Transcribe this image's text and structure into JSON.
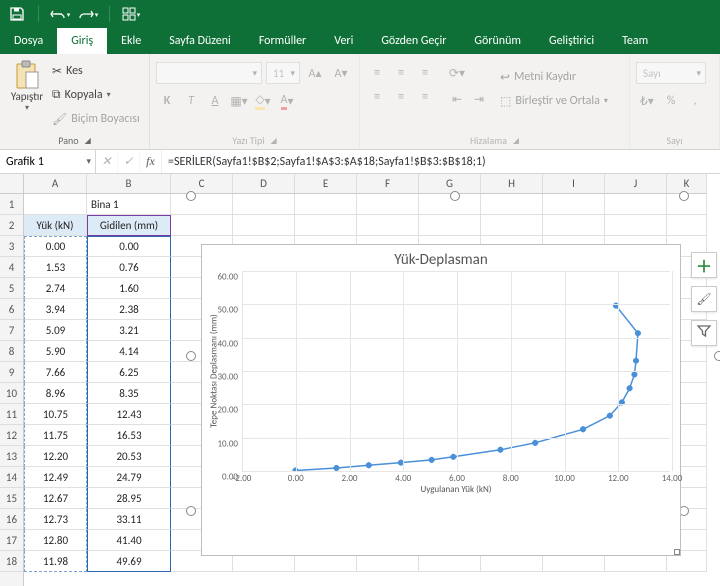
{
  "qat": {
    "items": [
      "save",
      "undo",
      "redo",
      "touch"
    ]
  },
  "ribbon": {
    "tabs": [
      "Dosya",
      "Giriş",
      "Ekle",
      "Sayfa Düzeni",
      "Formüller",
      "Veri",
      "Gözden Geçir",
      "Görünüm",
      "Geliştirici",
      "Team"
    ],
    "active": "Giriş",
    "paste_label": "Yapıştır",
    "clipboard": {
      "kes": "Kes",
      "kopyala": "Kopyala",
      "bicim": "Biçim Boyacısı",
      "group": "Pano"
    },
    "font": {
      "size": "11",
      "group": "Yazı Tipi",
      "bold": "K",
      "italic": "T",
      "underline": "A"
    },
    "align": {
      "wrap": "Metni Kaydır",
      "merge": "Birleştir ve Ortala",
      "group": "Hizalama"
    },
    "number": {
      "format": "Sayı",
      "group": "Sayı"
    }
  },
  "formula_bar": {
    "name": "Grafik 1",
    "fx": "fx",
    "formula": "=SERİLER(Sayfa1!$B$2;Sayfa1!$A$3:$A$18;Sayfa1!$B$3:$B$18;1)"
  },
  "columns": [
    "A",
    "B",
    "C",
    "D",
    "E",
    "F",
    "G",
    "H",
    "I",
    "J",
    "K"
  ],
  "sheet": {
    "header_title": "Bina 1",
    "colA_header": "Yük (kN)",
    "colB_header": "Gidilen (mm)",
    "rows": [
      {
        "a": "0.00",
        "b": "0.00"
      },
      {
        "a": "1.53",
        "b": "0.76"
      },
      {
        "a": "2.74",
        "b": "1.60"
      },
      {
        "a": "3.94",
        "b": "2.38"
      },
      {
        "a": "5.09",
        "b": "3.21"
      },
      {
        "a": "5.90",
        "b": "4.14"
      },
      {
        "a": "7.66",
        "b": "6.25"
      },
      {
        "a": "8.96",
        "b": "8.35"
      },
      {
        "a": "10.75",
        "b": "12.43"
      },
      {
        "a": "11.75",
        "b": "16.53"
      },
      {
        "a": "12.20",
        "b": "20.53"
      },
      {
        "a": "12.49",
        "b": "24.79"
      },
      {
        "a": "12.67",
        "b": "28.95"
      },
      {
        "a": "12.73",
        "b": "33.11"
      },
      {
        "a": "12.80",
        "b": "41.40"
      },
      {
        "a": "11.98",
        "b": "49.69"
      }
    ]
  },
  "chart_data": {
    "type": "scatter",
    "title": "Yük-Deplasman",
    "xlabel": "Uygulanan Yük (kN)",
    "ylabel": "Tepe Noktası Deplasmanı (mm)",
    "xlim": [
      -2.0,
      14.0
    ],
    "ylim": [
      0.0,
      60.0
    ],
    "xticks": [
      -2.0,
      0.0,
      2.0,
      4.0,
      6.0,
      8.0,
      10.0,
      12.0,
      14.0
    ],
    "yticks": [
      0.0,
      10.0,
      20.0,
      30.0,
      40.0,
      50.0,
      60.0
    ],
    "series": [
      {
        "name": "Bina 1",
        "x": [
          0.0,
          1.53,
          2.74,
          3.94,
          5.09,
          5.9,
          7.66,
          8.96,
          10.75,
          11.75,
          12.2,
          12.49,
          12.67,
          12.73,
          12.8,
          11.98
        ],
        "y": [
          0.0,
          0.76,
          1.6,
          2.38,
          3.21,
          4.14,
          6.25,
          8.35,
          12.43,
          16.53,
          20.53,
          24.79,
          28.95,
          33.11,
          41.4,
          49.69
        ]
      }
    ]
  }
}
